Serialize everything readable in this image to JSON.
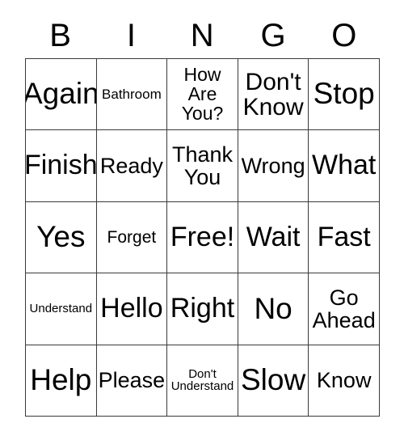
{
  "header": {
    "letters": [
      "B",
      "I",
      "N",
      "G",
      "O"
    ]
  },
  "colors": {
    "background": "#ffffff",
    "text": "#000000",
    "grid_line": "#3a3a3a"
  },
  "grid": {
    "rows": 5,
    "columns": 5,
    "cells": [
      [
        {
          "text": "Again",
          "size": "fs-4xl"
        },
        {
          "text": "Bathroom",
          "size": "fs-sm"
        },
        {
          "text": "How\nAre\nYou?",
          "size": "fs-lg"
        },
        {
          "text": "Don't\nKnow",
          "size": "fs-2xl"
        },
        {
          "text": "Stop",
          "size": "fs-4xl"
        }
      ],
      [
        {
          "text": "Finish",
          "size": "fs-3xl"
        },
        {
          "text": "Ready",
          "size": "fs-xl"
        },
        {
          "text": "Thank\nYou",
          "size": "fs-xl"
        },
        {
          "text": "Wrong",
          "size": "fs-xl"
        },
        {
          "text": "What",
          "size": "fs-3xl"
        }
      ],
      [
        {
          "text": "Yes",
          "size": "fs-4xl"
        },
        {
          "text": "Forget",
          "size": "fs-md"
        },
        {
          "text": "Free!",
          "size": "fs-3xl"
        },
        {
          "text": "Wait",
          "size": "fs-3xl"
        },
        {
          "text": "Fast",
          "size": "fs-3xl"
        }
      ],
      [
        {
          "text": "Understand",
          "size": "fs-xs"
        },
        {
          "text": "Hello",
          "size": "fs-3xl"
        },
        {
          "text": "Right",
          "size": "fs-3xl"
        },
        {
          "text": "No",
          "size": "fs-4xl"
        },
        {
          "text": "Go\nAhead",
          "size": "fs-xl"
        }
      ],
      [
        {
          "text": "Help",
          "size": "fs-4xl"
        },
        {
          "text": "Please",
          "size": "fs-xl"
        },
        {
          "text": "Don't\nUnderstand",
          "size": "fs-xs"
        },
        {
          "text": "Slow",
          "size": "fs-4xl"
        },
        {
          "text": "Know",
          "size": "fs-xl"
        }
      ]
    ]
  }
}
